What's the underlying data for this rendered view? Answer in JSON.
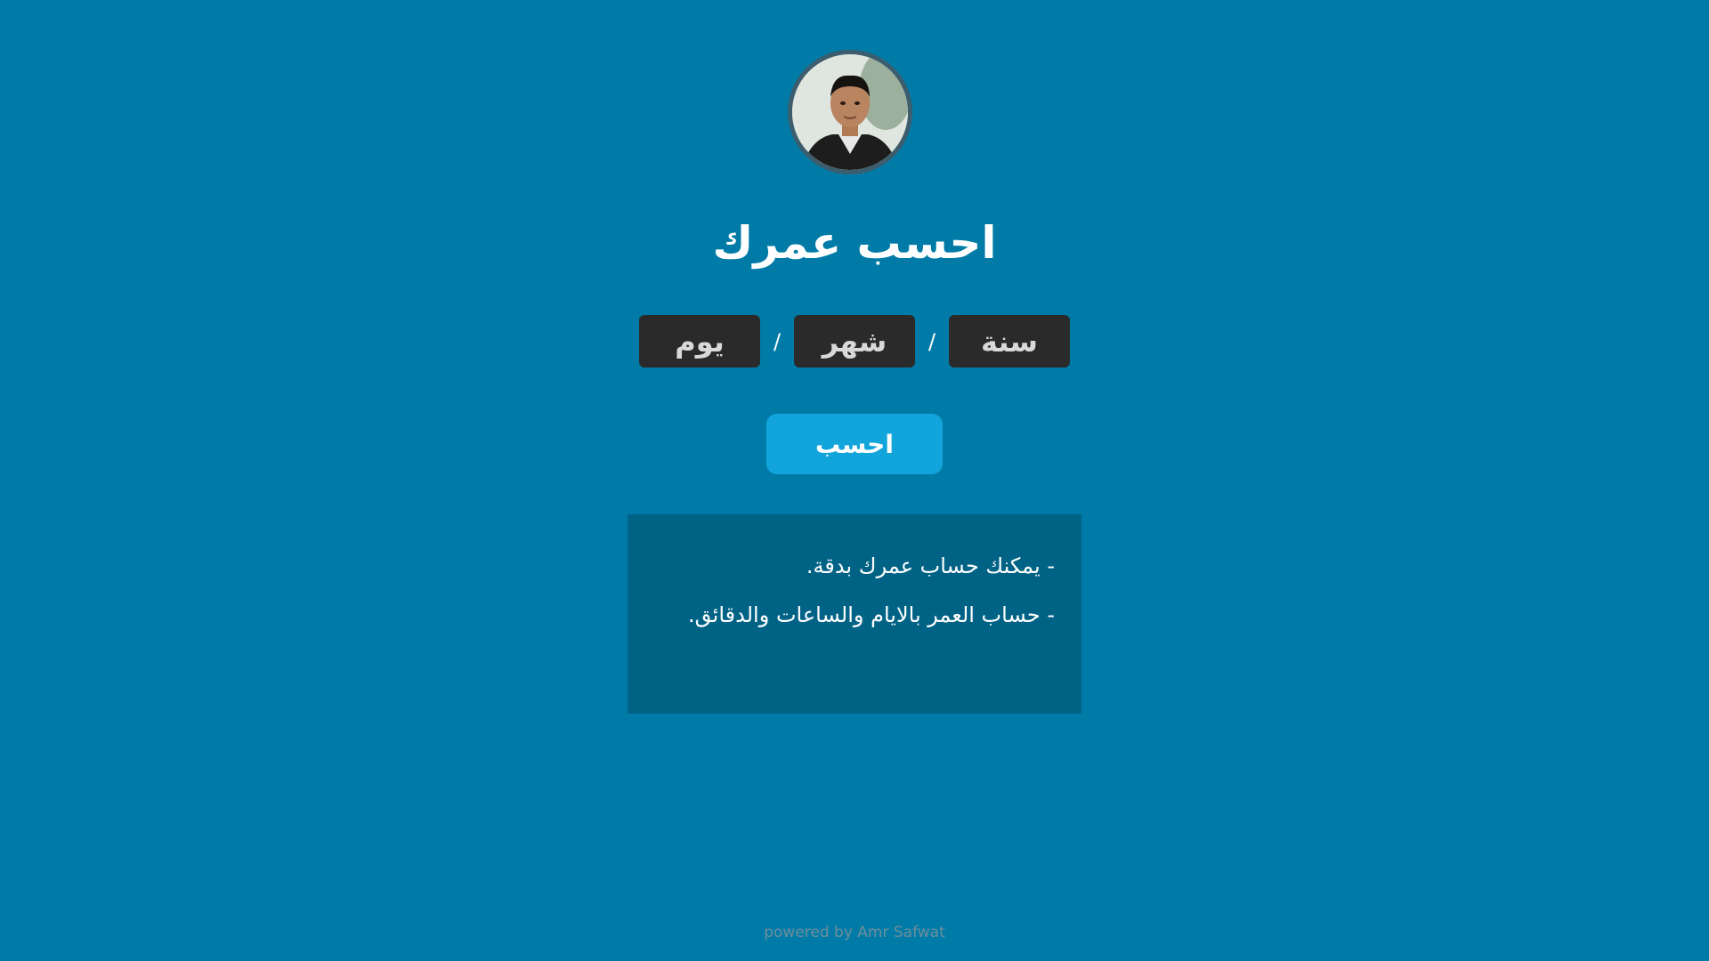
{
  "profile": {
    "avatar_alt": "profile photo"
  },
  "header": {
    "title": "احسب عمرك"
  },
  "date_inputs": {
    "year_placeholder": "سنة",
    "month_placeholder": "شهر",
    "day_placeholder": "يوم",
    "separator": "/"
  },
  "actions": {
    "calculate_label": "احسب"
  },
  "info": {
    "lines": [
      "- يمكنك حساب عمرك بدقة.",
      "- حساب العمر بالايام والساعات والدقائق."
    ]
  },
  "footer": {
    "credit": "powered by Amr Safwat"
  },
  "colors": {
    "background": "#007ba7",
    "input_bg": "#2a2a2a",
    "button_bg": "#12a5dc",
    "info_bg": "#006386"
  }
}
